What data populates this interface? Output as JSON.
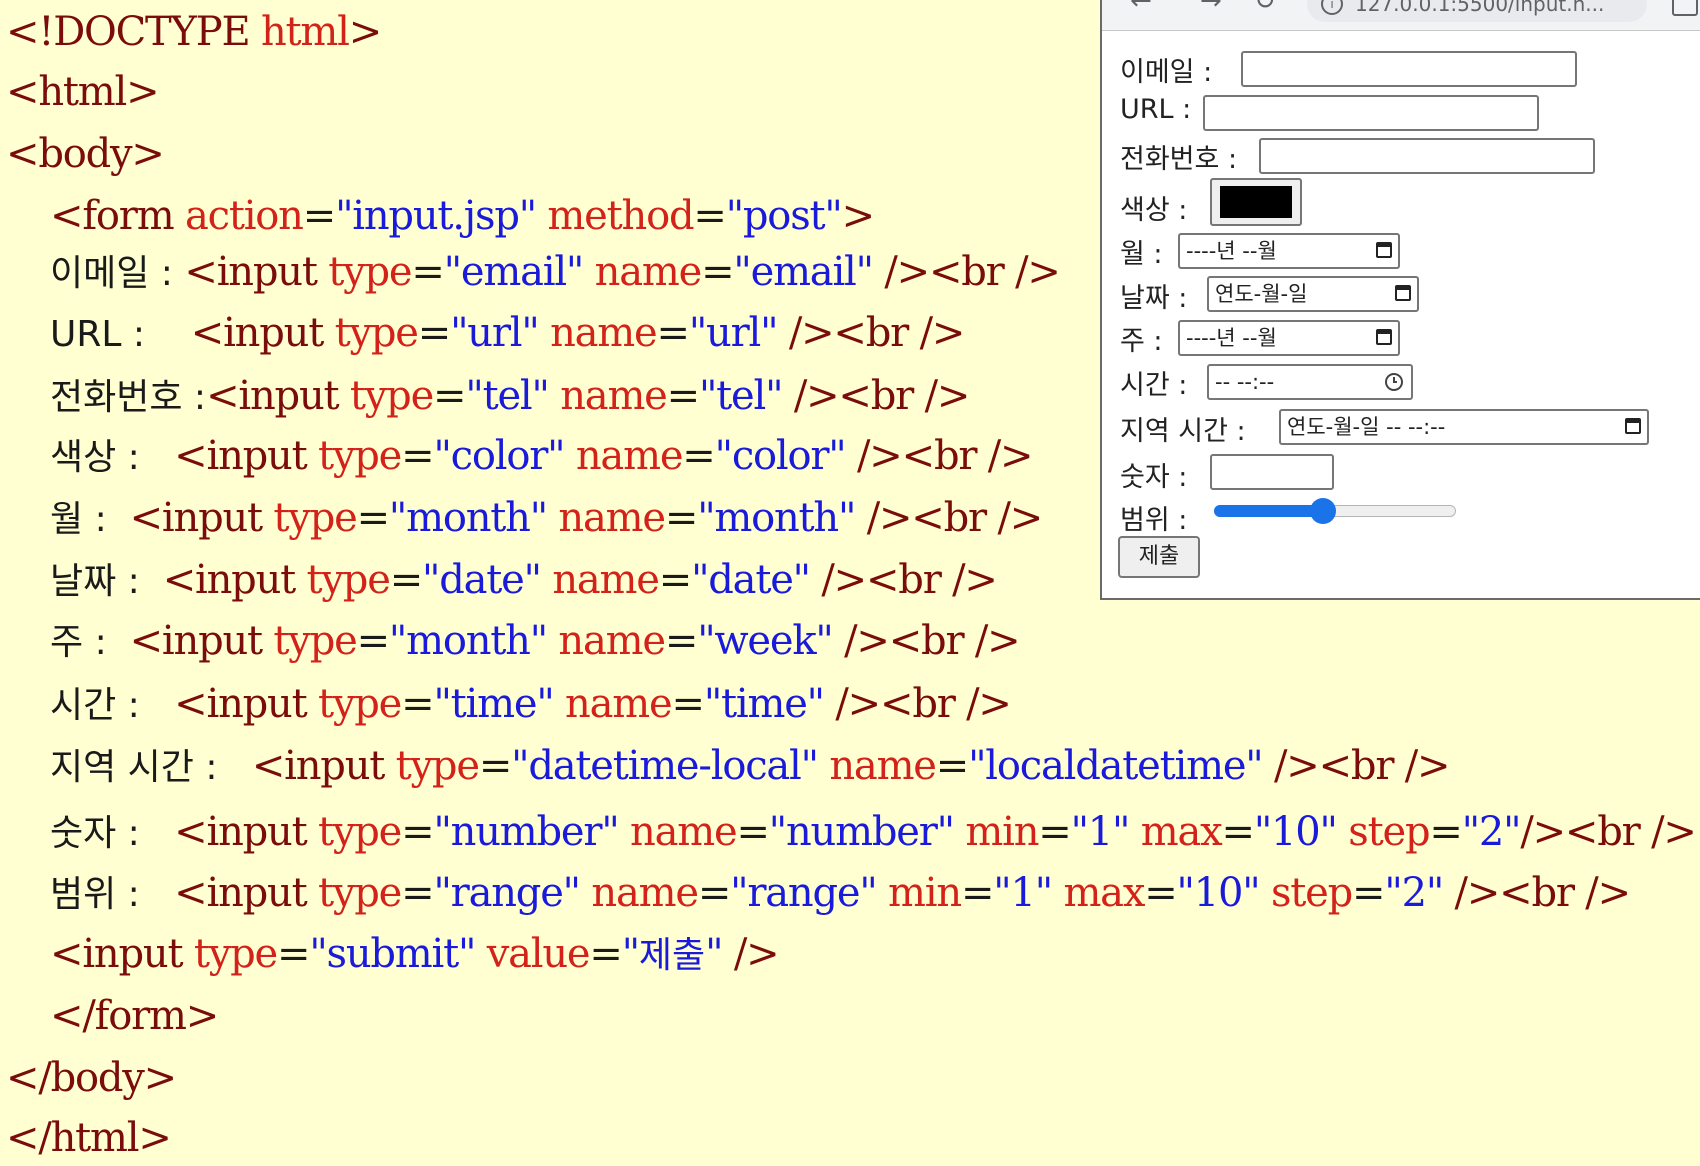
{
  "code": {
    "doctype": "<!DOCTYPE",
    "doctype_html": " html",
    "doctype_end": ">",
    "html_open": "<html>",
    "body_open": "<body>",
    "form_open_tag": "<form",
    "form_action_attr": " action",
    "form_action_val": "\"input.jsp\"",
    "form_method_attr": " method",
    "form_method_val": "\"post\"",
    "form_open_end": ">",
    "lines": [
      {
        "label": "이메일 : ",
        "type": "\"email\"",
        "name": "\"email\"",
        "extra": "",
        "end": " /><br />"
      },
      {
        "label": "URL :    ",
        "type": "\"url\"",
        "name": "\"url\"",
        "extra": "",
        "end": " /><br />"
      },
      {
        "label": "전화번호 :",
        "type": "\"tel\"",
        "name": "\"tel\"",
        "extra": "",
        "end": " /><br />"
      },
      {
        "label": "색상 :   ",
        "type": "\"color\"",
        "name": "\"color\"",
        "extra": "",
        "end": " /><br />"
      },
      {
        "label": "월 :  ",
        "type": "\"month\"",
        "name": "\"month\"",
        "extra": "",
        "end": " /><br />"
      },
      {
        "label": "날짜 :  ",
        "type": "\"date\"",
        "name": "\"date\"",
        "extra": "",
        "end": " /><br />"
      },
      {
        "label": "주 :  ",
        "type": "\"month\"",
        "name": "\"week\"",
        "extra": "",
        "end": " /><br />"
      },
      {
        "label": "시간 :   ",
        "type": "\"time\"",
        "name": "\"time\"",
        "extra": "",
        "end": " /><br />"
      },
      {
        "label": "지역 시간 :   ",
        "type": "\"datetime-local\"",
        "name": "\"localdatetime\"",
        "extra": "",
        "end": " /><br />"
      }
    ],
    "number_line": {
      "label": "숫자 :   ",
      "type": "\"number\"",
      "name": "\"number\"",
      "min": "\"1\"",
      "max": "\"10\"",
      "step": "\"2\"",
      "end": "/><br />"
    },
    "range_line": {
      "label": "범위 :   ",
      "type": "\"range\"",
      "name": "\"range\"",
      "min": "\"1\"",
      "max": "\"10\"",
      "step": "\"2\"",
      "end": " /><br />"
    },
    "submit_line": {
      "type": "\"submit\"",
      "value_open": "\"",
      "value_kor": "제출",
      "value_close": "\"",
      "end": " />"
    },
    "input_tag": "<input",
    "type_attr": " type",
    "name_attr": " name",
    "min_attr": " min",
    "max_attr": " max",
    "step_attr": " step",
    "value_attr": " value",
    "eq": "=",
    "form_close": "</form>",
    "body_close": "</body>",
    "html_close": "</html>"
  },
  "browser": {
    "url": "127.0.0.1:5500/input.h...",
    "form": {
      "email_label": "이메일 :",
      "url_label": "URL :",
      "tel_label": "전화번호 :",
      "color_label": "색상 :",
      "color_value": "#000000",
      "month_label": "월 :",
      "month_value": "----년 --월",
      "date_label": "날짜 :",
      "date_value": "연도-월-일",
      "week_label": "주 :",
      "week_value": "----년 --월",
      "time_label": "시간 :",
      "time_value": "-- --:--",
      "local_label": "지역 시간 :",
      "local_value": "연도-월-일 -- --:--",
      "number_label": "숫자 :",
      "range_label": "범위 :",
      "range_value": 5,
      "range_min": 1,
      "range_max": 10,
      "submit_label": "제출"
    }
  }
}
